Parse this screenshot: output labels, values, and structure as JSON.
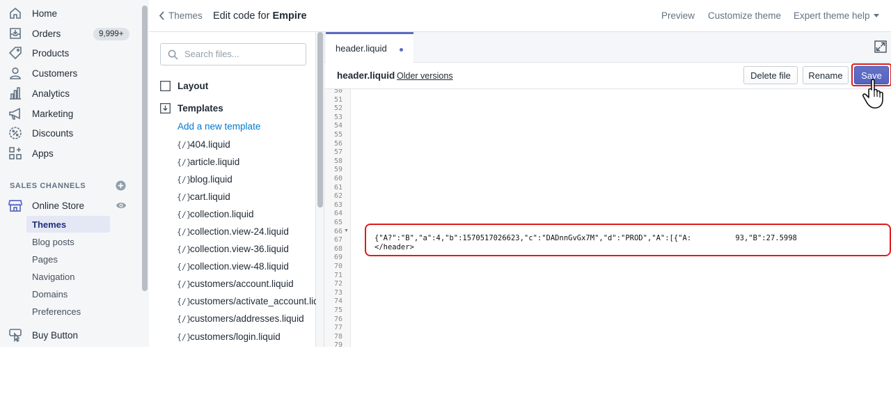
{
  "sidebar": {
    "items": [
      {
        "label": "Home",
        "icon": "home-icon"
      },
      {
        "label": "Orders",
        "icon": "orders-icon",
        "badge": "9,999+"
      },
      {
        "label": "Products",
        "icon": "tag-icon"
      },
      {
        "label": "Customers",
        "icon": "person-icon"
      },
      {
        "label": "Analytics",
        "icon": "bar-chart-icon"
      },
      {
        "label": "Marketing",
        "icon": "megaphone-icon"
      },
      {
        "label": "Discounts",
        "icon": "discount-icon"
      },
      {
        "label": "Apps",
        "icon": "apps-icon"
      }
    ],
    "sales_channels_title": "SALES CHANNELS",
    "online_store": {
      "label": "Online Store",
      "icon": "store-icon"
    },
    "subitems": [
      {
        "label": "Themes",
        "active": true
      },
      {
        "label": "Blog posts"
      },
      {
        "label": "Pages"
      },
      {
        "label": "Navigation"
      },
      {
        "label": "Domains"
      },
      {
        "label": "Preferences"
      }
    ],
    "buy_button": {
      "label": "Buy Button",
      "icon": "buy-button-icon"
    }
  },
  "topbar": {
    "back_label": "Themes",
    "title_prefix": "Edit code for ",
    "theme_name": "Empire",
    "preview": "Preview",
    "customize": "Customize theme",
    "help": "Expert theme help"
  },
  "filebrowser": {
    "search_placeholder": "Search files...",
    "layout_folder": "Layout",
    "templates_folder": "Templates",
    "add_template": "Add a new template",
    "liquid_icon": "{/}",
    "files": [
      "404.liquid",
      "article.liquid",
      "blog.liquid",
      "cart.liquid",
      "collection.liquid",
      "collection.view-24.liquid",
      "collection.view-36.liquid",
      "collection.view-48.liquid",
      "customers/account.liquid",
      "customers/activate_account.liquid",
      "customers/addresses.liquid",
      "customers/login.liquid"
    ]
  },
  "editor": {
    "tab_label": "header.liquid",
    "file_name": "header.liquid",
    "older_versions": "Older versions",
    "delete_label": "Delete file",
    "rename_label": "Rename",
    "save_label": "Save",
    "line_numbers": [
      "50",
      "51",
      "52",
      "53",
      "54",
      "55",
      "56",
      "57",
      "58",
      "59",
      "60",
      "61",
      "62",
      "63",
      "64",
      "65",
      "66",
      "67",
      "68",
      "69",
      "70",
      "71",
      "72",
      "73",
      "74",
      "75",
      "76",
      "77",
      "78",
      "79"
    ],
    "code_line_67": "{\"A?\":\"B\",\"a\":4,\"b\":1570517026623,\"c\":\"DADnnGvGx7M\",\"d\":\"PROD\",\"A\":[{\"A:          93,\"B\":27.5998",
    "code_line_68": "</header>"
  },
  "colors": {
    "accent": "#5c6ac4",
    "link": "#007ace",
    "highlight": "#e01a1a"
  }
}
